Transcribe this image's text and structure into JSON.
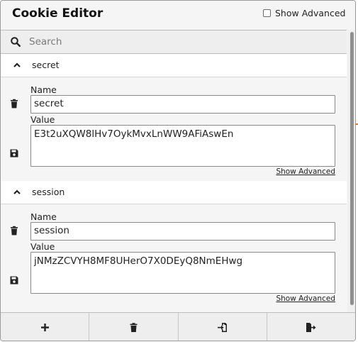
{
  "header": {
    "title": "Cookie Editor",
    "show_advanced_label": "Show Advanced",
    "show_advanced_checked": false
  },
  "search": {
    "placeholder": "Search",
    "value": ""
  },
  "cookies": [
    {
      "name": "secret",
      "name_label": "Name",
      "value_label": "Value",
      "value": "E3t2uXQW8lHv7OykMvxLnWW9AFiAswEn",
      "show_advanced_link": "Show Advanced",
      "expanded": true
    },
    {
      "name": "session",
      "name_label": "Name",
      "value_label": "Value",
      "value": "jNMzZCVYH8MF8UHerO7X0DEyQ8NmEHwg",
      "show_advanced_link": "Show Advanced",
      "expanded": true
    }
  ],
  "footer": {
    "buttons": [
      {
        "action": "add",
        "icon": "plus-icon"
      },
      {
        "action": "delete-all",
        "icon": "trash-icon"
      },
      {
        "action": "import",
        "icon": "import-icon"
      },
      {
        "action": "export",
        "icon": "export-icon"
      }
    ]
  },
  "icons": {
    "search": "search-icon",
    "collapse": "chevron-up-icon",
    "delete": "trash-icon",
    "save": "floppy-disk-icon"
  },
  "colors": {
    "panel_bg": "#f5f5f5",
    "border": "#9a9a9a",
    "accent_edge": "#e8722c"
  }
}
